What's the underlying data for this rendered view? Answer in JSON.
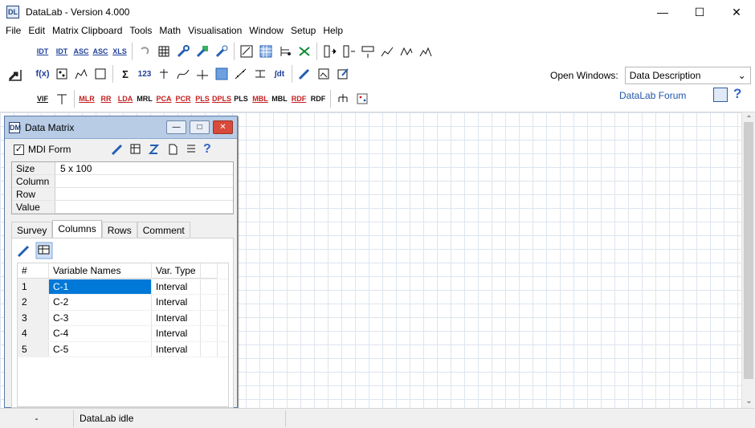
{
  "window": {
    "title": "DataLab - Version 4.000",
    "app_icon": "DL",
    "controls": {
      "minimize": "—",
      "maximize": "☐",
      "close": "✕"
    }
  },
  "menu": [
    "File",
    "Edit",
    "Matrix Clipboard",
    "Tools",
    "Math",
    "Visualisation",
    "Window",
    "Setup",
    "Help"
  ],
  "toolbar": {
    "row1": [
      "IDT",
      "IDT",
      "ASC",
      "ASC",
      "XLS"
    ],
    "row3": [
      "VIF",
      "",
      "MLR",
      "RR",
      "LDA",
      "MRL",
      "PCA",
      "PCR",
      "PLS",
      "DPLS",
      "PLS",
      "MBL",
      "MBL",
      "RDF",
      "RDF"
    ],
    "row2_labels": [
      "f(x)",
      "123",
      "∫dt"
    ],
    "open_windows_label": "Open Windows:",
    "open_windows_value": "Data Description",
    "forum_label": "DataLab Forum",
    "help_symbol": "?"
  },
  "mdi": {
    "title": "Data Matrix",
    "title_icon": "DM",
    "buttons": {
      "minimize": "—",
      "restore": "□",
      "close": "✕"
    },
    "form_label": "MDI Form",
    "form_help": "?",
    "info": [
      {
        "key": "Size",
        "value": "5 x 100"
      },
      {
        "key": "Column",
        "value": ""
      },
      {
        "key": "Row",
        "value": ""
      },
      {
        "key": "Value",
        "value": ""
      }
    ],
    "tabs": [
      "Survey",
      "Columns",
      "Rows",
      "Comment"
    ],
    "table": {
      "headers": [
        "#",
        "Variable Names",
        "Var. Type",
        ""
      ],
      "rows": [
        [
          "1",
          "C-1",
          "Interval",
          ""
        ],
        [
          "2",
          "C-2",
          "Interval",
          ""
        ],
        [
          "3",
          "C-3",
          "Interval",
          ""
        ],
        [
          "4",
          "C-4",
          "Interval",
          ""
        ],
        [
          "5",
          "C-5",
          "Interval",
          ""
        ]
      ]
    }
  },
  "status": {
    "left": "-",
    "message": "DataLab idle"
  }
}
